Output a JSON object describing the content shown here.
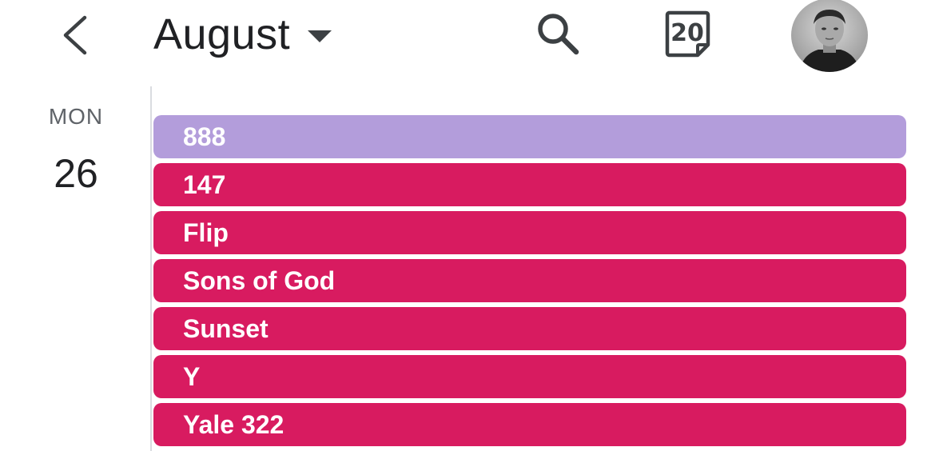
{
  "header": {
    "month": "August",
    "today_day": "20",
    "icons": {
      "back": "chevron-left-icon",
      "dropdown": "caret-down-icon",
      "search": "search-icon",
      "today": "calendar-today-icon",
      "avatar": "user-avatar"
    }
  },
  "day": {
    "name": "MON",
    "number": "26"
  },
  "events": [
    {
      "title": "888",
      "color": "#b39ddb"
    },
    {
      "title": "147",
      "color": "#d81b60"
    },
    {
      "title": "Flip",
      "color": "#d81b60"
    },
    {
      "title": "Sons of God",
      "color": "#d81b60"
    },
    {
      "title": "Sunset",
      "color": "#d81b60"
    },
    {
      "title": "Y",
      "color": "#d81b60"
    },
    {
      "title": "Yale 322",
      "color": "#d81b60"
    }
  ]
}
